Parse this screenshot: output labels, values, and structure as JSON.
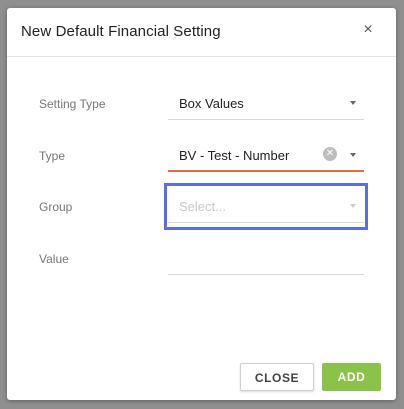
{
  "dialog": {
    "title": "New Default Financial Setting",
    "close_icon": "×"
  },
  "fields": {
    "setting_type": {
      "label": "Setting Type",
      "value": "Box Values"
    },
    "type": {
      "label": "Type",
      "value": "BV - Test -  Number",
      "clear_icon": "✕"
    },
    "group": {
      "label": "Group",
      "placeholder": "Select..."
    },
    "value": {
      "label": "Value",
      "value": ""
    }
  },
  "buttons": {
    "close_label": "CLOSE",
    "add_label": "ADD"
  },
  "colors": {
    "accent_add": "#8bc34a",
    "error_underline": "#e8693f",
    "highlight_border": "#5b6ee1"
  },
  "icons": [
    "close-icon",
    "clear-icon",
    "dropdown-caret-icon"
  ]
}
